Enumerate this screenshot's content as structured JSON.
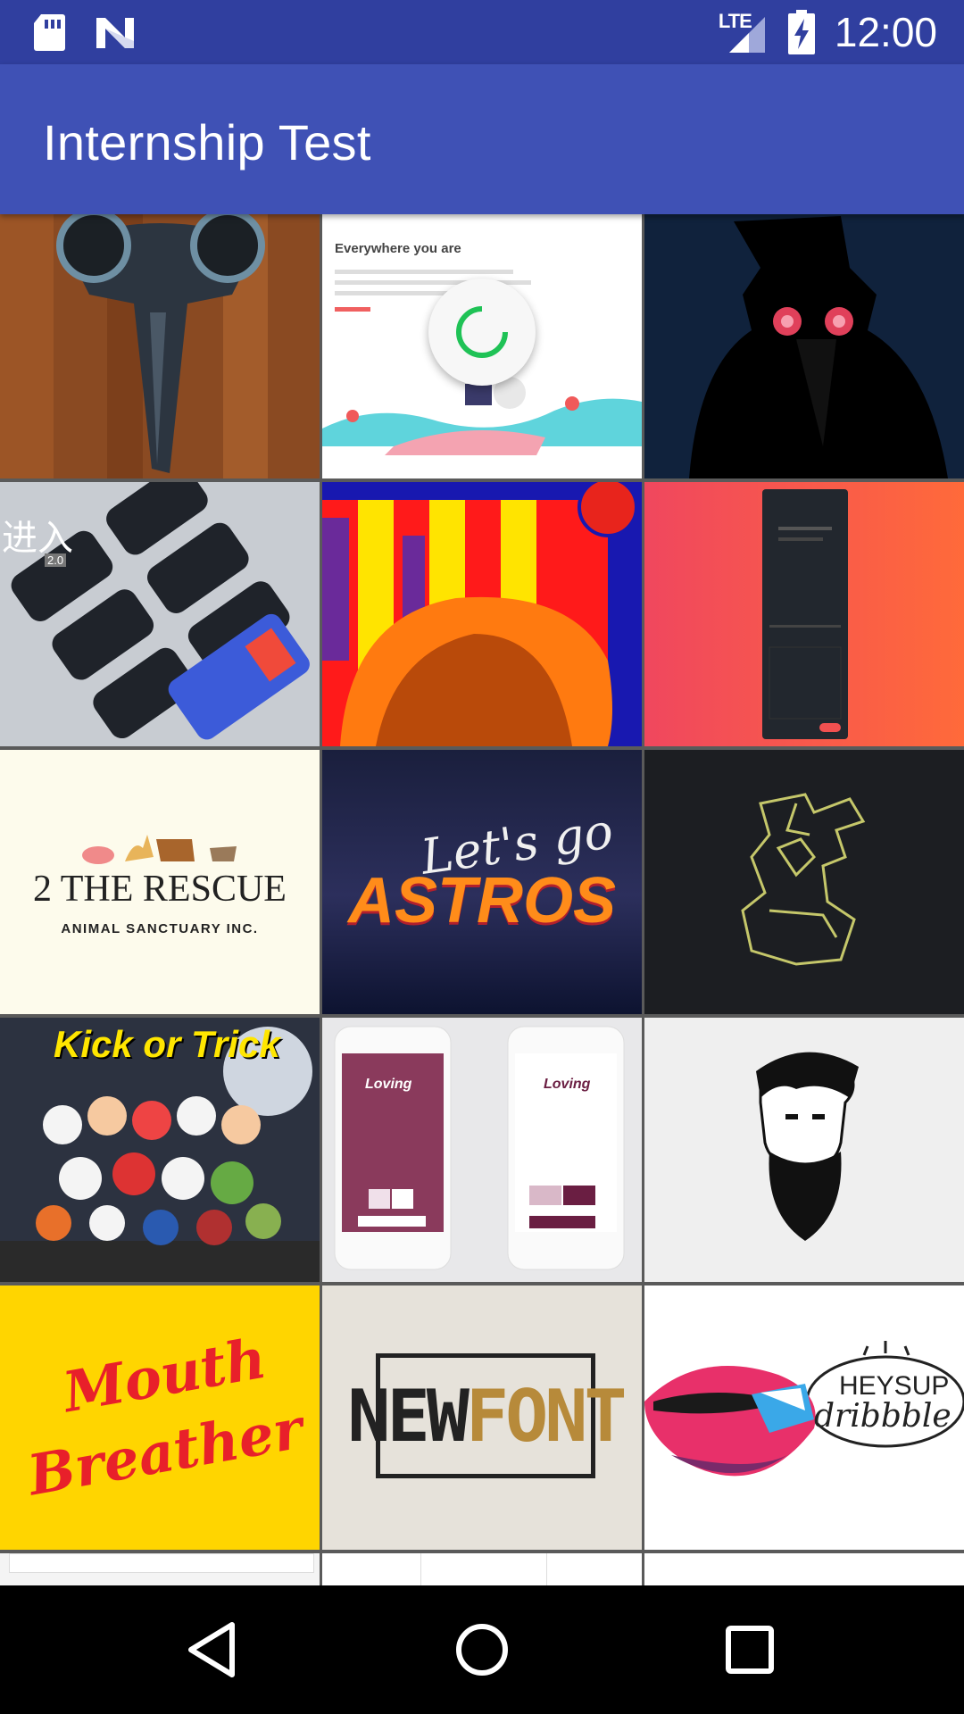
{
  "status_bar": {
    "time": "12:00",
    "network": "LTE",
    "icons": [
      "sd-card-icon",
      "notification-n-icon",
      "signal-icon",
      "battery-charging-icon"
    ]
  },
  "app_bar": {
    "title": "Internship Test"
  },
  "tiles": [
    {
      "row": 0,
      "col": 0,
      "subject": "plague-doctor-leather-mask-photo"
    },
    {
      "row": 0,
      "col": 1,
      "subject": "website-landing-illustration",
      "heading": "Everywhere you are"
    },
    {
      "row": 0,
      "col": 2,
      "subject": "plague-doctor-silhouette"
    },
    {
      "row": 1,
      "col": 0,
      "subject": "phone-mockups",
      "heading": "进入",
      "badge": "2.0"
    },
    {
      "row": 1,
      "col": 1,
      "subject": "kale-pop-art"
    },
    {
      "row": 1,
      "col": 2,
      "subject": "mobile-app-dark-screen"
    },
    {
      "row": 2,
      "col": 0,
      "subject": "animal-sanctuary-logo",
      "heading": "2 THE RESCUE",
      "subheading": "ANIMAL SANCTUARY INC."
    },
    {
      "row": 2,
      "col": 1,
      "subject": "astros-lettering",
      "heading": "Let's go",
      "subheading": "ASTROS"
    },
    {
      "row": 2,
      "col": 2,
      "subject": "line-art-figure"
    },
    {
      "row": 3,
      "col": 0,
      "subject": "kick-or-trick-characters",
      "heading": "Kick or Trick"
    },
    {
      "row": 3,
      "col": 1,
      "subject": "loving-app-mockups",
      "heading": "Loving"
    },
    {
      "row": 3,
      "col": 2,
      "subject": "bearded-man-logo"
    },
    {
      "row": 4,
      "col": 0,
      "subject": "mouth-breather-lettering",
      "heading": "Mouth",
      "subheading": "Breather"
    },
    {
      "row": 4,
      "col": 1,
      "subject": "newfont-logo",
      "heading": "NEW",
      "subheading": "FONT"
    },
    {
      "row": 4,
      "col": 2,
      "subject": "heysup-dribbble-lips",
      "heading": "HEYSUP",
      "subheading": "dribbble"
    }
  ],
  "loading": true,
  "nav": {
    "back": "back-icon",
    "home": "home-icon",
    "recents": "recents-icon"
  },
  "colors": {
    "status_bar": "#303f9f",
    "app_bar": "#3f51b5",
    "spinner": "#1fc256"
  }
}
